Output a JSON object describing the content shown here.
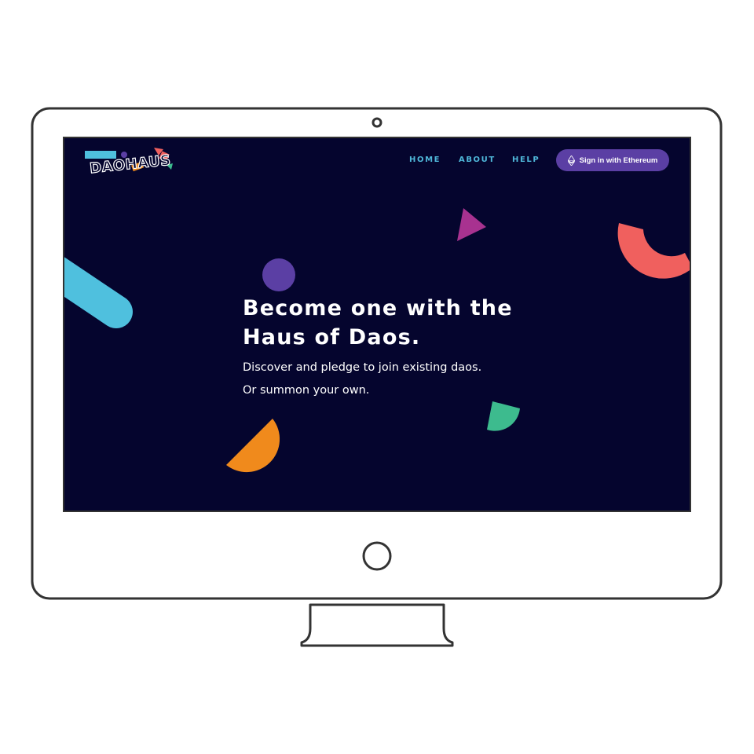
{
  "app": {
    "logo_text": "DAOHAUS"
  },
  "nav": {
    "links": [
      {
        "label": "HOME"
      },
      {
        "label": "ABOUT"
      },
      {
        "label": "HELP"
      }
    ],
    "signin_label": "Sign in with Ethereum",
    "signin_icon": "ethereum-icon"
  },
  "hero": {
    "title_line1": "Become one with the",
    "title_line2": "Haus of Daos.",
    "sub_line1": "Discover and pledge to join existing daos.",
    "sub_line2": "Or summon your own."
  },
  "colors": {
    "background": "#05052e",
    "nav_link": "#4fb7d9",
    "button": "#5b3fa4",
    "shape_blue": "#4fc0de",
    "shape_purple_circle": "#5b3fa4",
    "shape_magenta": "#a83290",
    "shape_coral": "#f0605e",
    "shape_orange": "#f08a1c",
    "shape_green": "#3dbb8e"
  }
}
